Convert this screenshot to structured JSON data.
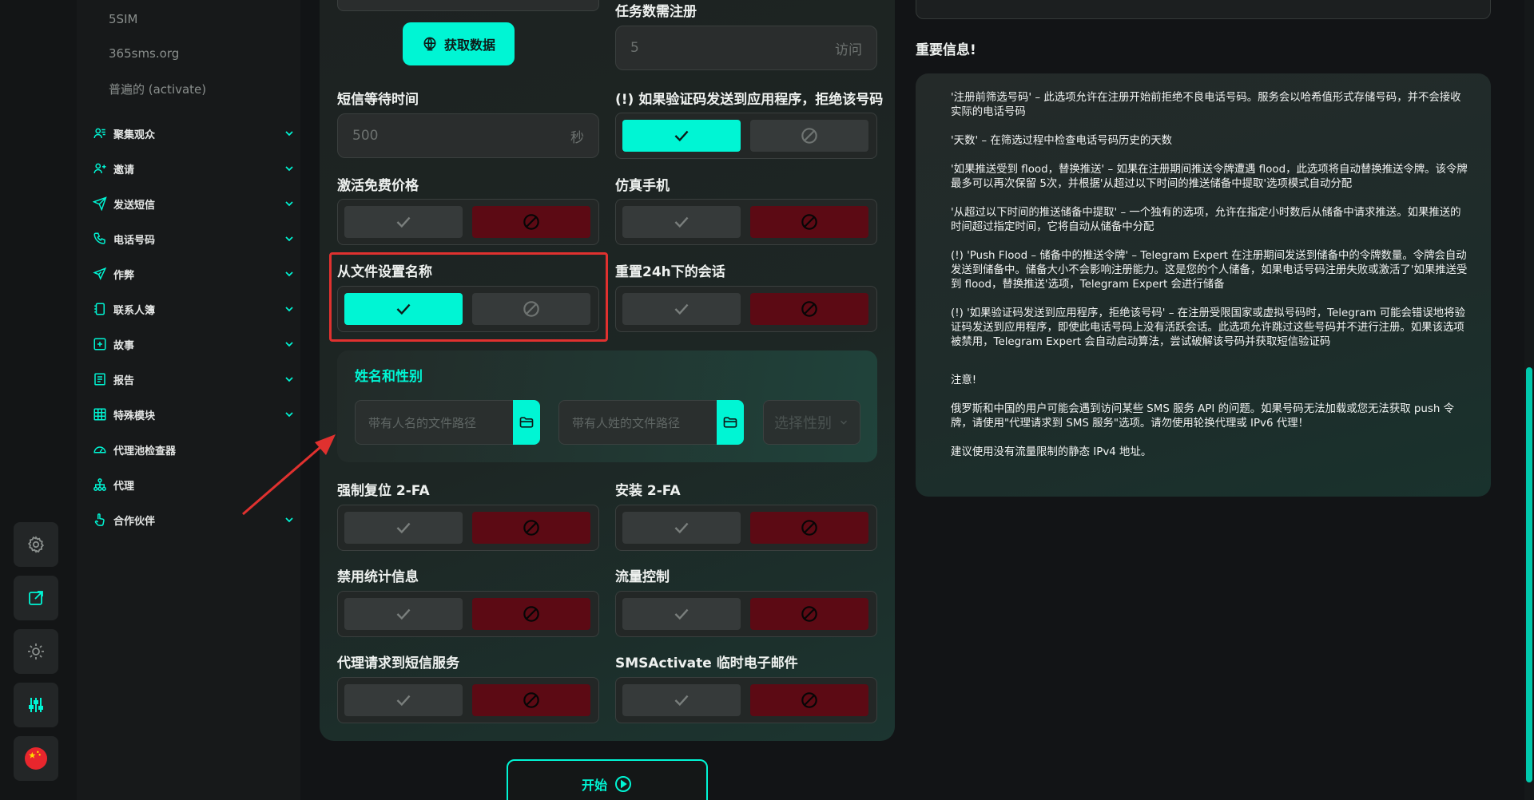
{
  "sidebar": {
    "sub_items": [
      "5SIM",
      "365sms.org",
      "普遍的 (activate)"
    ],
    "nav": [
      {
        "label": "聚集观众",
        "icon": "users-icon",
        "has_chevron": true
      },
      {
        "label": "邀请",
        "icon": "user-add-icon",
        "has_chevron": true
      },
      {
        "label": "发送短信",
        "icon": "send-icon",
        "has_chevron": true
      },
      {
        "label": "电话号码",
        "icon": "phone-icon",
        "has_chevron": true
      },
      {
        "label": "作弊",
        "icon": "paper-plane-icon",
        "has_chevron": true
      },
      {
        "label": "联系人簿",
        "icon": "contacts-icon",
        "has_chevron": true
      },
      {
        "label": "故事",
        "icon": "plus-square-icon",
        "has_chevron": true
      },
      {
        "label": "报告",
        "icon": "report-icon",
        "has_chevron": true
      },
      {
        "label": "特殊模块",
        "icon": "grid-icon",
        "has_chevron": true
      },
      {
        "label": "代理池检查器",
        "icon": "gauge-icon",
        "has_chevron": false
      },
      {
        "label": "代理",
        "icon": "network-icon",
        "has_chevron": false
      },
      {
        "label": "合作伙伴",
        "icon": "hand-icon",
        "has_chevron": true
      }
    ]
  },
  "rail": [
    "gear-icon",
    "external-link-icon",
    "sun-icon",
    "sliders-icon",
    "china-flag-icon"
  ],
  "form": {
    "fetch_label": "获取数据",
    "task_reg_label": "任务数需注册",
    "task_reg_value": "5",
    "task_reg_unit": "访问",
    "sms_wait_label": "短信等待时间",
    "sms_wait_value": "500",
    "sms_wait_unit": "秒",
    "reject_label": "(!) 如果验证码发送到应用程序，拒绝该号码",
    "free_price_label": "激活免费价格",
    "emulate_label": "仿真手机",
    "name_from_file_label": "从文件设置名称",
    "reset_sessions_label": "重置24h下的会话",
    "name_gender_title": "姓名和性别",
    "first_name_placeholder": "带有人名的文件路径",
    "last_name_placeholder": "带有人姓的文件路径",
    "gender_placeholder": "选择性别",
    "force_2fa_label": "强制复位 2-FA",
    "install_2fa_label": "安装 2-FA",
    "disable_stats_label": "禁用统计信息",
    "traffic_label": "流量控制",
    "proxy_sms_label": "代理请求到短信服务",
    "sms_email_label": "SMSActivate 临时电子邮件",
    "start_label": "开始"
  },
  "toggles": {
    "reject": true,
    "free_price": false,
    "emulate": false,
    "name_from_file": true,
    "reset_sessions": false,
    "force_2fa": false,
    "install_2fa": false,
    "disable_stats": false,
    "traffic": false,
    "proxy_sms": false,
    "sms_email": false
  },
  "info": {
    "title": "重要信息!",
    "paragraphs": [
      "'注册前筛选号码' – 此选项允许在注册开始前拒绝不良电话号码。服务会以哈希值形式存储号码，并不会接收实际的电话号码",
      "'天数' – 在筛选过程中检查电话号码历史的天数",
      "'如果推送受到 flood，替换推送' – 如果在注册期间推送令牌遭遇 flood，此选项将自动替换推送令牌。该令牌最多可以再次保留 5次，并根据'从超过以下时间的推送储备中提取'选项模式自动分配",
      "'从超过以下时间的推送储备中提取' – 一个独有的选项，允许在指定小时数后从储备中请求推送。如果推送的时间超过指定时间，它将自动从储备中分配",
      "(!) 'Push Flood – 储备中的推送令牌' – Telegram Expert 在注册期间发送到储备中的令牌数量。令牌会自动发送到储备中。储备大小不会影响注册能力。这是您的个人储备，如果电话号码注册失败或激活了'如果推送受到 flood，替换推送'选项，Telegram Expert 会进行储备",
      "(!) '如果验证码发送到应用程序，拒绝该号码' – 在注册受限国家或虚拟号码时，Telegram 可能会错误地将验证码发送到应用程序，即使此电话号码上没有活跃会话。此选项允许跳过这些号码并不进行注册。如果该选项被禁用，Telegram Expert 会自动启动算法，尝试破解该号码并获取短信验证码",
      "注意!",
      "俄罗斯和中国的用户可能会遇到访问某些 SMS 服务 API 的问题。如果号码无法加载或您无法获取 push 令牌，请使用\"代理请求到 SMS 服务\"选项。请勿使用轮换代理或 IPv6 代理！",
      "建议使用没有流量限制的静态 IPv4 地址。"
    ]
  },
  "colors": {
    "accent": "#00f5d4",
    "danger": "#5c0a14",
    "highlight": "#e0312f"
  }
}
